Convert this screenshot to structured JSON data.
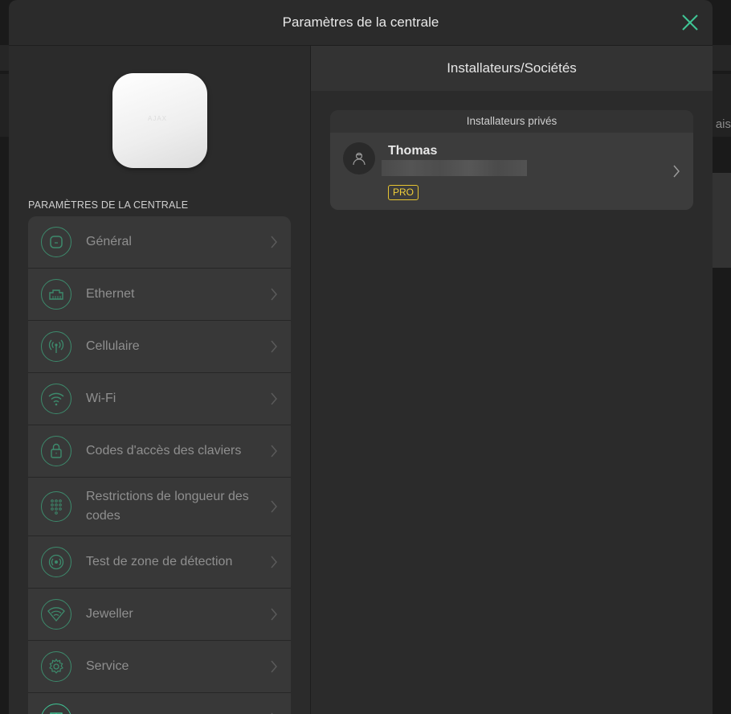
{
  "modal": {
    "title": "Paramètres de la centrale",
    "accent_color": "#3fc595"
  },
  "background": {
    "peek_text": "ais"
  },
  "hub": {
    "logo_text": "AJAX"
  },
  "left": {
    "section_label": "PARAMÈTRES DE LA CENTRALE",
    "items": [
      {
        "label": "Général",
        "icon": "hub-general-icon"
      },
      {
        "label": "Ethernet",
        "icon": "ethernet-icon"
      },
      {
        "label": "Cellulaire",
        "icon": "cellular-antenna-icon"
      },
      {
        "label": "Wi-Fi",
        "icon": "wifi-icon"
      },
      {
        "label": "Codes d'accès des claviers",
        "icon": "keypad-lock-icon"
      },
      {
        "label": "Restrictions de longueur des codes",
        "icon": "keypad-grid-icon"
      },
      {
        "label": "Test de zone de détection",
        "icon": "detection-zone-icon"
      },
      {
        "label": "Jeweller",
        "icon": "jeweller-signal-icon"
      },
      {
        "label": "Service",
        "icon": "service-gear-icon"
      }
    ]
  },
  "right": {
    "title": "Installateurs/Sociétés",
    "section_title": "Installateurs privés",
    "installer": {
      "name": "Thomas",
      "email": "",
      "badge": "PRO",
      "badge_color": "#e6c430",
      "avatar_icon": "installer-avatar-icon"
    }
  }
}
